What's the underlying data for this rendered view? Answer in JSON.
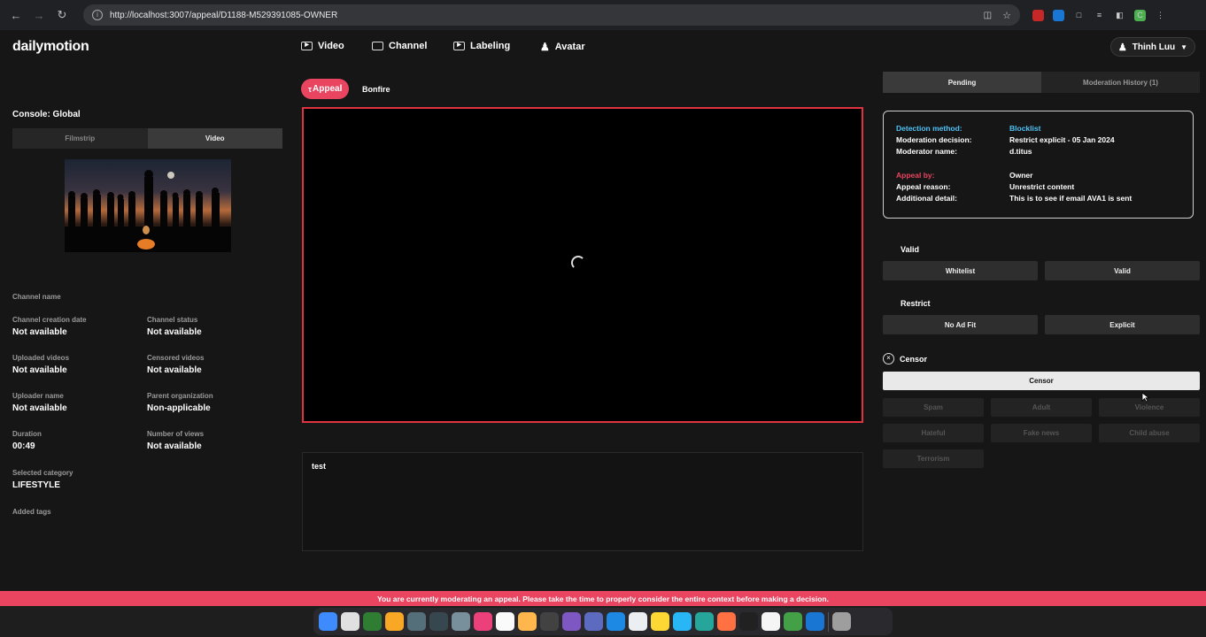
{
  "browser": {
    "url": "http://localhost:3007/appeal/D1188-M529391085-OWNER"
  },
  "app": {
    "logo": "dailymotion",
    "nav": [
      {
        "label": "Video"
      },
      {
        "label": "Channel"
      },
      {
        "label": "Labeling"
      },
      {
        "label": "Avatar"
      }
    ],
    "user": "Thinh Luu"
  },
  "left": {
    "console_title": "Console: Global",
    "tabs": [
      "Filmstrip",
      "Video"
    ],
    "active_tab": "Video",
    "fields": {
      "channel_name": {
        "label": "Channel name",
        "value": ""
      },
      "channel_creation_date": {
        "label": "Channel creation date",
        "value": "Not available"
      },
      "channel_status": {
        "label": "Channel status",
        "value": "Not available"
      },
      "uploaded_videos": {
        "label": "Uploaded videos",
        "value": "Not available"
      },
      "censored_videos": {
        "label": "Censored videos",
        "value": "Not available"
      },
      "uploader_name": {
        "label": "Uploader name",
        "value": "Not available"
      },
      "parent_organization": {
        "label": "Parent organization",
        "value": "Non-applicable"
      },
      "duration": {
        "label": "Duration",
        "value": "00:49"
      },
      "number_of_views": {
        "label": "Number of views",
        "value": "Not available"
      },
      "selected_category": {
        "label": "Selected category",
        "value": "LIFESTYLE"
      },
      "added_tags": {
        "label": "Added tags",
        "value": ""
      }
    }
  },
  "center": {
    "tag": "Appeal",
    "title": "Bonfire",
    "notes": "test"
  },
  "right": {
    "tabs": [
      "Pending",
      "Moderation History (1)"
    ],
    "active_tab": "Pending",
    "details": {
      "detection_method": {
        "label": "Detection method:",
        "value": "Blocklist"
      },
      "moderation_decision": {
        "label": "Moderation decision:",
        "value": "Restrict explicit - 05 Jan 2024"
      },
      "moderator_name": {
        "label": "Moderator name:",
        "value": "d.titus"
      },
      "appeal_by": {
        "label": "Appeal by:",
        "value": "Owner"
      },
      "appeal_reason": {
        "label": "Appeal reason:",
        "value": "Unrestrict content"
      },
      "additional_detail": {
        "label": "Additional detail:",
        "value": "This is to see if email AVA1 is sent"
      }
    },
    "valid": {
      "title": "Valid",
      "buttons": [
        "Whitelist",
        "Valid"
      ]
    },
    "restrict": {
      "title": "Restrict",
      "buttons": [
        "No Ad Fit",
        "Explicit"
      ]
    },
    "censor": {
      "title": "Censor",
      "button": "Censor",
      "categories": [
        "Spam",
        "Adult",
        "Violence",
        "Hateful",
        "Fake news",
        "Child abuse",
        "Terrorism"
      ]
    }
  },
  "banner": "You are currently moderating an appeal. Please take the time to properly consider the entire context before making a decision.",
  "colors": {
    "accent": "#e94560",
    "info_blue": "#4fc3f7"
  }
}
